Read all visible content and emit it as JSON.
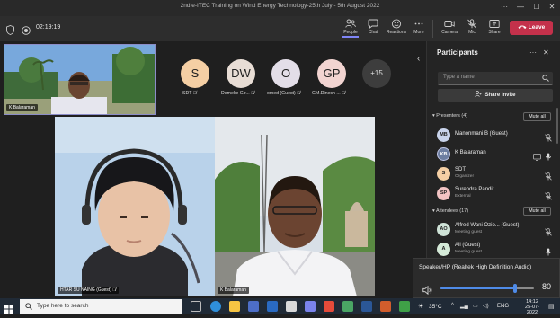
{
  "window": {
    "title": "2nd e-ITEC Training on Wind Energy Technology-25th July - 5th August 2022"
  },
  "toolbar": {
    "timer": "02:19:19",
    "items": [
      {
        "label": "People",
        "icon": "people-icon"
      },
      {
        "label": "Chat",
        "icon": "chat-icon"
      },
      {
        "label": "Reactions",
        "icon": "reactions-icon"
      },
      {
        "label": "More",
        "icon": "more-icon"
      },
      {
        "label": "Camera",
        "icon": "camera-icon"
      },
      {
        "label": "Mic",
        "icon": "mic-icon"
      },
      {
        "label": "Share",
        "icon": "share-icon"
      }
    ],
    "leave_label": "Leave"
  },
  "stage": {
    "self_name": "K Balaraman",
    "avatars": [
      {
        "initials": "S",
        "label": "SDT",
        "color": "#f5cfa4"
      },
      {
        "initials": "DW",
        "label": "Demeke Gir...",
        "color": "#e8ddd5"
      },
      {
        "initials": "O",
        "label": "omed (Guest)",
        "color": "#e3dee8"
      },
      {
        "initials": "GP",
        "label": "GM.Dinesh ...",
        "color": "#f2d4d1"
      }
    ],
    "overflow_count": "+15",
    "left_video_name": "HTAR SU NAING (Guest)",
    "right_video_name": "K Balaraman"
  },
  "panel": {
    "title": "Participants",
    "search_placeholder": "Type a name",
    "share_invite_label": "Share invite",
    "presenters_header": "Presenters (4)",
    "mute_all_label": "Mute all",
    "presenters": [
      {
        "initials": "MB",
        "name": "Manonmani B (Guest)",
        "sub": "",
        "color": "#c9d4ec"
      },
      {
        "initials": "KB",
        "name": "K Balaraman",
        "sub": "",
        "color": "#6d7ea1"
      },
      {
        "initials": "S",
        "name": "SDT",
        "sub": "Organizer",
        "color": "#f5cfa4"
      },
      {
        "initials": "SP",
        "name": "Surendra Pandit",
        "sub": "External",
        "color": "#f3c4c4"
      }
    ],
    "attendees_header": "Attendees (17)",
    "attendees": [
      {
        "initials": "AO",
        "name": "Alfred Wani Ozio... (Guest)",
        "sub": "Meeting guest",
        "color": "#cfe3d7"
      },
      {
        "initials": "A",
        "name": "Ali (Guest)",
        "sub": "Meeting guest",
        "color": "#d5ead8"
      }
    ]
  },
  "speaker_popup": {
    "device": "Speaker/HP (Realtek High Definition Audio)",
    "volume": "80",
    "volume_fraction": 0.8
  },
  "taskbar": {
    "search_placeholder": "Type here to search",
    "temperature": "35°C",
    "language": "ENG",
    "time": "14:12",
    "date": "25-07-2022"
  },
  "colors": {
    "accent": "#6264a7",
    "leave": "#c4314b",
    "slider": "#4f8be8"
  }
}
